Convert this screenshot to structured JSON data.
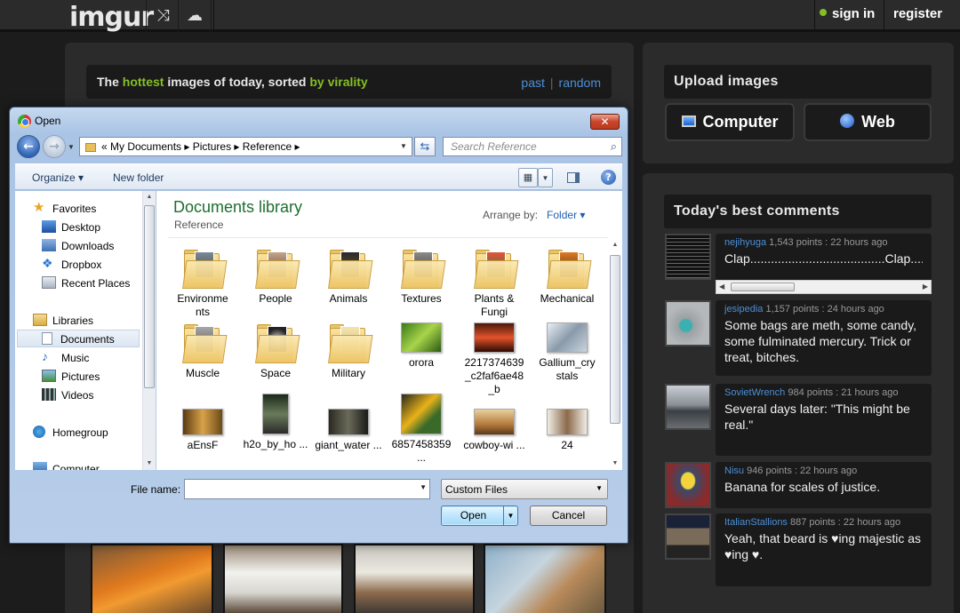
{
  "topbar": {
    "logo": "imgur",
    "random_icon": "shuffle-icon",
    "upload_icon": "cloud-upload-icon",
    "sign_in": "sign in",
    "register": "register",
    "online_color": "#85bf25"
  },
  "gallery": {
    "tagline": {
      "prefix": "The ",
      "hottest": "hottest",
      "middle": " images of today, sorted ",
      "virality": "by virality",
      "past": "past",
      "separator": "|",
      "random": "random"
    }
  },
  "upload": {
    "title": "Upload images",
    "computer": "Computer",
    "web": "Web"
  },
  "comments": {
    "title": "Today's best comments",
    "items": [
      {
        "user": "nejihyuga",
        "meta": " 1,543 points : 22 hours ago",
        "text": "Clap.......................................Clap....."
      },
      {
        "user": "jesipedia",
        "meta": " 1,157 points : 24 hours ago",
        "text": "Some bags are meth, some candy, some fulminated mercury. Trick or treat, bitches."
      },
      {
        "user": "SovietWrench",
        "meta": " 984 points : 21 hours ago",
        "text": "Several days later: \"This might be real.\""
      },
      {
        "user": "Nisu",
        "meta": " 946 points : 22 hours ago",
        "text": "Banana for scales of justice."
      },
      {
        "user": "ItalianStallions",
        "meta": " 887 points : 22 hours ago",
        "text": "Yeah, that beard is ♥ing majestic as ♥ing ♥."
      }
    ]
  },
  "dialog": {
    "title": "Open",
    "breadcrumb": "«  My Documents  ▸  Pictures  ▸  Reference  ▸",
    "search_placeholder": "Search Reference",
    "organize": "Organize ▾",
    "new_folder": "New folder",
    "nav": {
      "favorites": "Favorites",
      "desktop": "Desktop",
      "downloads": "Downloads",
      "dropbox": "Dropbox",
      "recent": "Recent Places",
      "libraries": "Libraries",
      "documents": "Documents",
      "music": "Music",
      "pictures": "Pictures",
      "videos": "Videos",
      "homegroup": "Homegroup",
      "computer": "Computer"
    },
    "library_title": "Documents library",
    "library_sub": "Reference",
    "arrange_label": "Arrange by:",
    "arrange_value": "Folder ▾",
    "items": [
      "Environme nts",
      "People",
      "Animals",
      "Textures",
      "Plants & Fungi",
      "Mechanical",
      "Muscle",
      "Space",
      "Military",
      "orora",
      "2217374639 _c2faf6ae48 _b",
      "Gallium_cry stals",
      "aEnsF",
      "h2o_by_ho ...",
      "giant_water ...",
      "6857458359 ...",
      "cowboy-wi ...",
      "24"
    ],
    "file_name_label": "File name:",
    "file_name_value": "",
    "file_type": "Custom Files",
    "open": "Open",
    "cancel": "Cancel"
  }
}
